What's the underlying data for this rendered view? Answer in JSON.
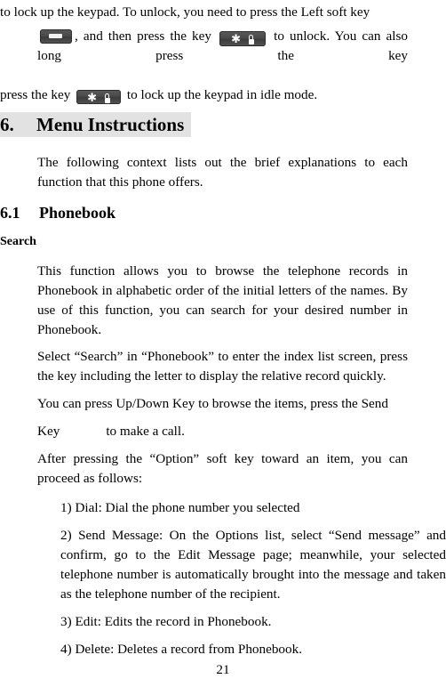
{
  "document": {
    "page_number": "21",
    "heading_highlight_color": "#e2e2e2",
    "key_color": "#4a4a4a"
  },
  "intro": {
    "line1": "to lock up the keypad. To unlock, you need to press the Left soft key",
    "after_soft_key": ", and then press the key",
    "after_star_key": "to unlock. You can also long press the key",
    "after_star_key2": "to lock up the keypad in idle mode.",
    "soft_key_icon": "soft-key-icon",
    "star_lock_key_icon": "star-lock-key-icon"
  },
  "section": {
    "number": "6.",
    "title": "Menu Instructions",
    "intro_paragraph": "The following context lists out the brief explanations to each function that this phone offers."
  },
  "subsection": {
    "number": "6.1",
    "title": "Phonebook",
    "topic": "Search"
  },
  "paragraphs": {
    "p1": "This function allows you to browse the telephone records in Phonebook in alphabetic order of the initial letters of the names. By use of this function, you can search for your desired number in Phonebook.",
    "p2": "Select “Search” in “Phonebook” to enter the index list screen, press the key including the letter to display the relative record quickly.",
    "p3": "You can press Up/Down Key to browse the items, press the Send",
    "p4_before": "Key",
    "p4_after": "to make a call.",
    "p5": "After pressing the “Option” soft key toward an item, you can proceed as follows:"
  },
  "options_list": [
    "1) Dial: Dial the phone number you selected",
    "2) Send Message: On the Options list, select “Send message” and confirm, go to the Edit Message page; meanwhile, your selected telephone number is automatically brought into the message and taken as the telephone number of the recipient.",
    "3) Edit: Edits the record in Phonebook.",
    "4) Delete: Deletes a record from Phonebook."
  ]
}
